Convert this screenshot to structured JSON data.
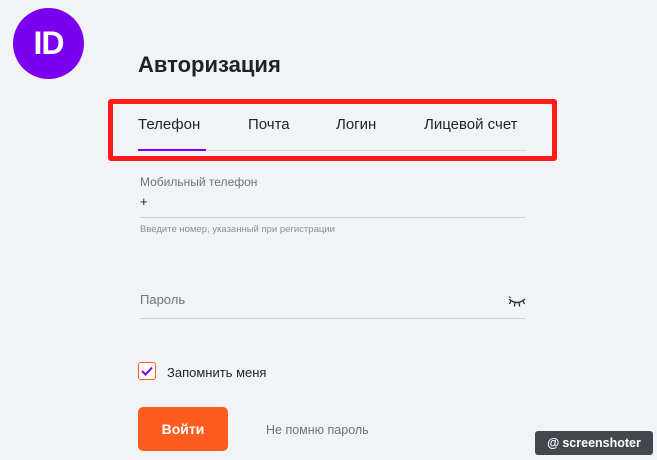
{
  "logo": {
    "text": "ID"
  },
  "page": {
    "title": "Авторизация"
  },
  "tabs": [
    {
      "label": "Телефон",
      "active": true
    },
    {
      "label": "Почта",
      "active": false
    },
    {
      "label": "Логин",
      "active": false
    },
    {
      "label": "Лицевой счет",
      "active": false
    }
  ],
  "phone": {
    "label": "Мобильный телефон",
    "value": "+",
    "hint": "Введите номер, указанный при регистрации"
  },
  "password": {
    "placeholder": "Пароль",
    "icon": "eye-closed-icon"
  },
  "remember": {
    "label": "Запомнить меня",
    "checked": true
  },
  "buttons": {
    "login": "Войти",
    "forgot": "Не помню пароль"
  },
  "watermark": {
    "text": "screenshoter"
  },
  "colors": {
    "accent_purple": "#7b00f0",
    "accent_orange": "#ff5c1f",
    "highlight_red": "#ff1a1a",
    "background": "#f2f3f5"
  }
}
